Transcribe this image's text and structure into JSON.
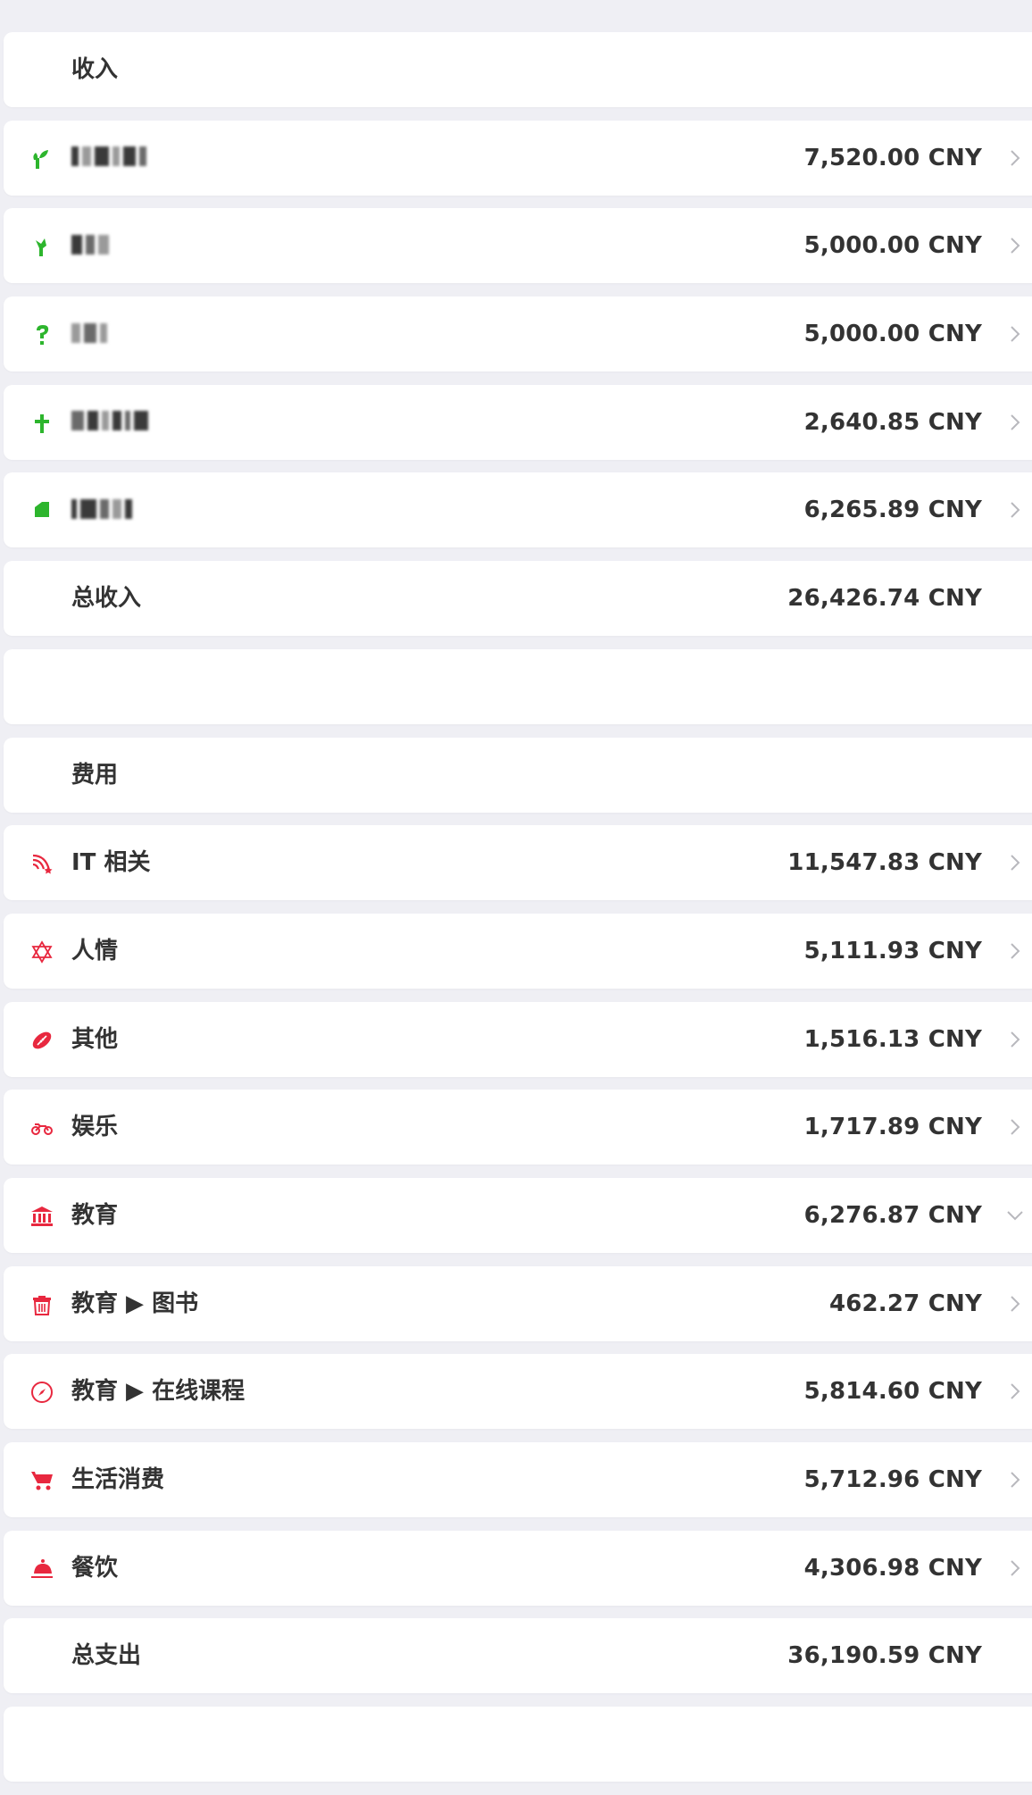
{
  "income": {
    "header": "收入",
    "items": [
      {
        "icon": "plant-icon",
        "label": "",
        "amount": "7,520.00 CNY"
      },
      {
        "icon": "flower-icon",
        "label": "",
        "amount": "5,000.00 CNY"
      },
      {
        "icon": "question-icon",
        "label": "",
        "amount": "5,000.00 CNY"
      },
      {
        "icon": "cross-icon",
        "label": "",
        "amount": "2,640.85 CNY"
      },
      {
        "icon": "bookmark-icon",
        "label": "",
        "amount": "6,265.89 CNY"
      }
    ],
    "total_label": "总收入",
    "total_amount": "26,426.74 CNY"
  },
  "expense": {
    "header": "费用",
    "items": [
      {
        "icon": "rss-icon",
        "label": "IT 相关",
        "amount": "11,547.83 CNY"
      },
      {
        "icon": "star-of-david-icon",
        "label": "人情",
        "amount": "5,111.93 CNY"
      },
      {
        "icon": "football-icon",
        "label": "其他",
        "amount": "1,516.13 CNY"
      },
      {
        "icon": "motorcycle-icon",
        "label": "娱乐",
        "amount": "1,717.89 CNY"
      },
      {
        "icon": "bank-icon",
        "label": "教育",
        "amount": "6,276.87 CNY"
      },
      {
        "icon": "trash-icon",
        "label": "教育 ▶ 图书",
        "amount": "462.27 CNY"
      },
      {
        "icon": "compass-icon",
        "label": "教育 ▶ 在线课程",
        "amount": "5,814.60 CNY"
      },
      {
        "icon": "cart-icon",
        "label": "生活消费",
        "amount": "5,712.96 CNY"
      },
      {
        "icon": "service-bell-icon",
        "label": "餐饮",
        "amount": "4,306.98 CNY"
      }
    ],
    "total_label": "总支出",
    "total_amount": "36,190.59 CNY"
  },
  "colors": {
    "income_icon": "#2db52d",
    "expense_icon": "#e8283f",
    "background": "#efeff4",
    "text": "#333333",
    "chevron": "#b8b8bd"
  }
}
